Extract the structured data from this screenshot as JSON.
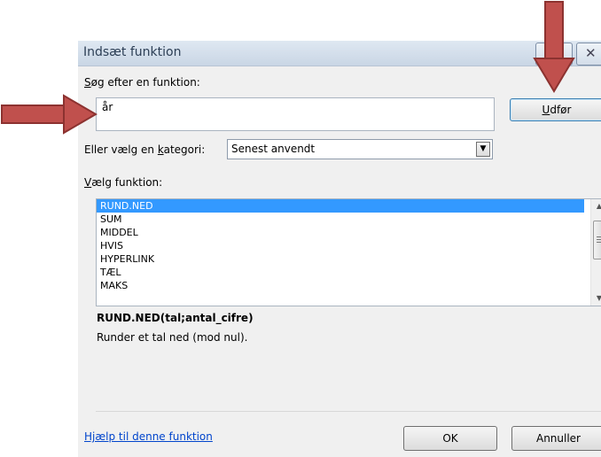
{
  "dialog": {
    "title": "Indsæt funktion"
  },
  "search": {
    "label_accesskey": "S",
    "label_rest": "øg efter en funktion:",
    "value": "år",
    "go_accesskey": "U",
    "go_rest": "dfør"
  },
  "category": {
    "label_prefix": "Eller vælg en ",
    "label_accesskey": "k",
    "label_suffix": "ategori:",
    "selected": "Senest anvendt"
  },
  "function_list": {
    "label_accesskey": "V",
    "label_rest": "ælg funktion:",
    "items": [
      "RUND.NED",
      "SUM",
      "MIDDEL",
      "HVIS",
      "HYPERLINK",
      "TÆL",
      "MAKS"
    ],
    "selected_index": 0
  },
  "details": {
    "signature": "RUND.NED(tal;antal_cifre)",
    "description": "Runder et tal ned (mod nul)."
  },
  "footer": {
    "help_link": "Hjælp til denne funktion",
    "ok_label": "OK",
    "cancel_label": "Annuller"
  },
  "colors": {
    "selection": "#3399ff",
    "annotation_arrow": "#c0504d"
  },
  "icons": {
    "close": "close-icon",
    "dropdown": "chevron-down-icon",
    "scroll_up": "scroll-up-icon",
    "scroll_down": "scroll-down-icon"
  }
}
